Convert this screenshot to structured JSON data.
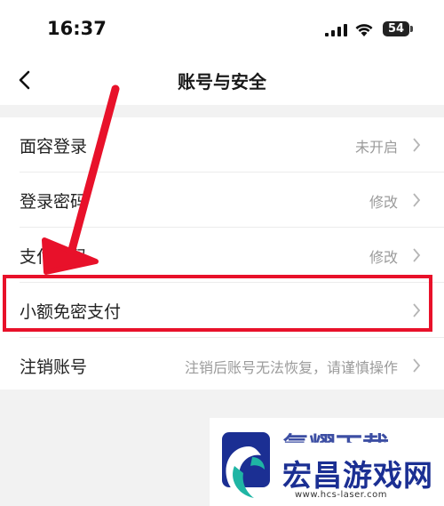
{
  "status_bar": {
    "time": "16:37",
    "battery": "54"
  },
  "nav": {
    "title": "账号与安全"
  },
  "rows": [
    {
      "label": "面容登录",
      "value": "未开启"
    },
    {
      "label": "登录密码",
      "value": "修改"
    },
    {
      "label": "支付密码",
      "value": "修改"
    },
    {
      "label": "小额免密支付",
      "value": ""
    },
    {
      "label": "注销账号",
      "value": "注销后账号无法恢复，请谨慎操作"
    }
  ],
  "colors": {
    "highlight": "#e8112a",
    "brand": "#1b2f93"
  },
  "watermark": {
    "name": "宏昌游戏网",
    "url": "www.hcs-laser.com",
    "faded_text": "氢耀下载"
  },
  "icons": [
    "back-arrow-icon",
    "chevron-right-icon",
    "cellular-signal-icon",
    "wifi-icon",
    "battery-icon",
    "red-arrow-annotation-icon",
    "watermark-logo-icon"
  ]
}
